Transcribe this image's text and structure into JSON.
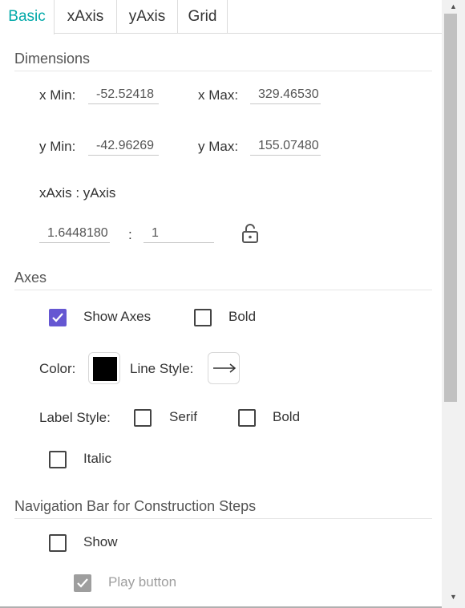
{
  "tabs": [
    {
      "label": "Basic",
      "active": true
    },
    {
      "label": "xAxis",
      "active": false
    },
    {
      "label": "yAxis",
      "active": false
    },
    {
      "label": "Grid",
      "active": false
    }
  ],
  "dimensions": {
    "title": "Dimensions",
    "x_min_label": "x Min:",
    "x_min_value": "-52.52418",
    "x_max_label": "x Max:",
    "x_max_value": "329.46530",
    "y_min_label": "y Min:",
    "y_min_value": "-42.96269",
    "y_max_label": "y Max:",
    "y_max_value": "155.07480",
    "ratio_label": "xAxis : yAxis",
    "ratio_x_value": "1.6448180",
    "ratio_separator": ":",
    "ratio_y_value": "1",
    "lock_icon": "lock-open-icon"
  },
  "axes": {
    "title": "Axes",
    "show_axes_label": "Show Axes",
    "show_axes_checked": true,
    "bold_label": "Bold",
    "bold_checked": false,
    "color_label": "Color:",
    "color_value": "#000000",
    "line_style_label": "Line Style:",
    "line_style_icon": "arrow-right-icon",
    "label_style_label": "Label Style:",
    "serif_label": "Serif",
    "serif_checked": false,
    "label_bold_label": "Bold",
    "label_bold_checked": false,
    "italic_label": "Italic",
    "italic_checked": false
  },
  "navigation": {
    "title": "Navigation Bar for Construction Steps",
    "show_label": "Show",
    "show_checked": false,
    "play_button_label": "Play button",
    "play_button_checked": true,
    "play_button_disabled": true
  },
  "colors": {
    "accent": "#00a8a8",
    "checkbox": "#6557d2",
    "disabled": "#9e9e9e"
  }
}
